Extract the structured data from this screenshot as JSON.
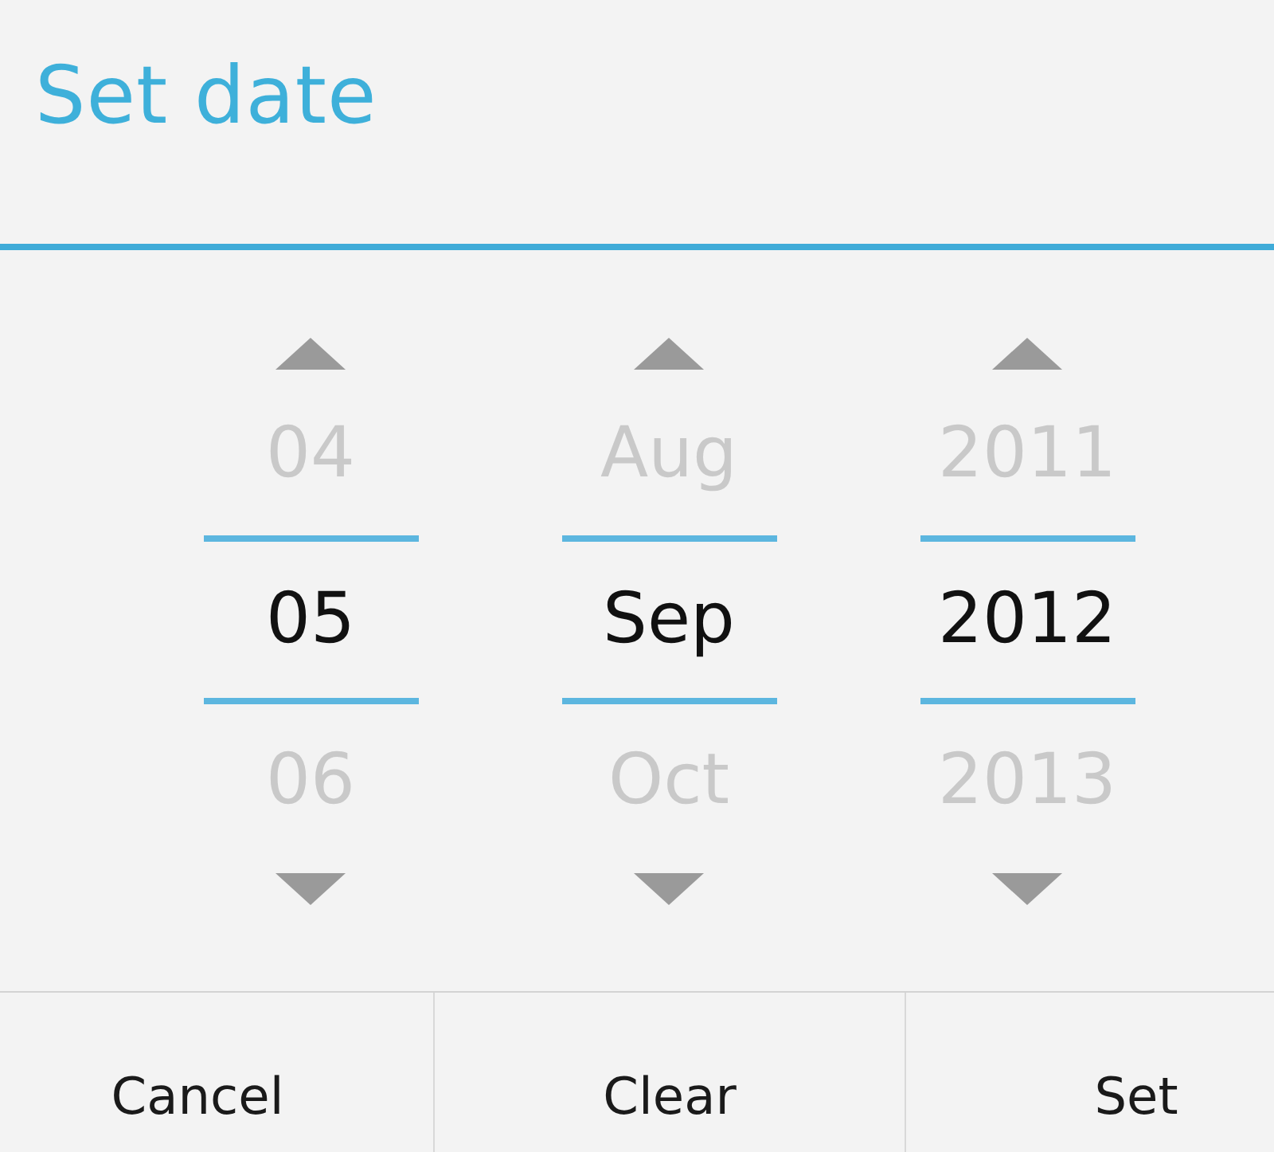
{
  "dialog": {
    "title": "Set date"
  },
  "pickers": [
    {
      "previous": "04",
      "value": "05",
      "next": "06"
    },
    {
      "previous": "Aug",
      "value": "Sep",
      "next": "Oct"
    },
    {
      "previous": "2011",
      "value": "2012",
      "next": "2013"
    }
  ],
  "buttons": [
    {
      "label": "Cancel"
    },
    {
      "label": "Clear"
    },
    {
      "label": "Set"
    }
  ]
}
